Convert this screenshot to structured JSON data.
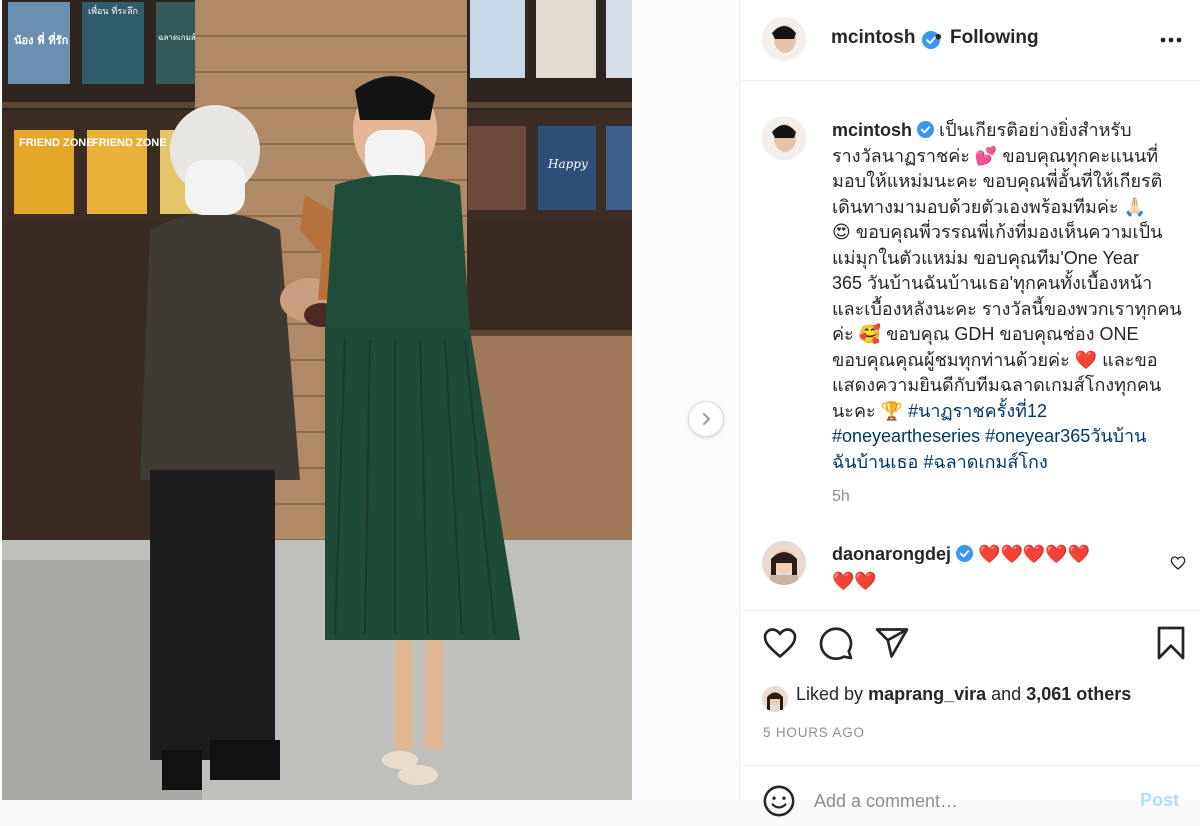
{
  "post": {
    "author": {
      "username": "mcintosh",
      "verified": true,
      "follow_status": "Following",
      "separator": "•"
    },
    "caption": {
      "username": "mcintosh",
      "lines": [
        "เป็นเกียรติอย่างยิ่งสำหรับ",
        "รางวัลนาฏราชค่ะ 💕 ขอบคุณทุกคะแนนที่",
        "มอบให้แหม่มนะคะ ขอบคุณพี่อั้นที่ให้เกียรติ",
        "เดินทางมามอบด้วยตัวเองพร้อมทีมค่ะ 🙏🏻",
        "😍 ขอบคุณพี่วรรณพี่เก้งที่มองเห็นความเป็น",
        "แม่มุกในตัวแหม่ม ขอบคุณทีม'One Year",
        "365 วันบ้านฉันบ้านเธอ'ทุกคนทั้งเบื้องหน้า",
        "และเบื้องหลังนะคะ รางวัลนี้ของพวกเราทุกคน",
        "ค่ะ 🥰 ขอบคุณ GDH ขอบคุณช่อง ONE",
        "ขอบคุณคุณผู้ชมทุกท่านด้วยค่ะ ❤️ และขอ",
        "แสดงความยินดีกับทีมฉลาดเกมส์โกงทุกคน"
      ],
      "last_line_prefix": "นะคะ 🏆 ",
      "hashtags": [
        "#นาฏราชครั้งที่12",
        "#oneyeartheseries",
        "#oneyear365วันบ้าน",
        "ฉันบ้านเธอ",
        "#ฉลาดเกมส์โกง"
      ],
      "age": "5h"
    },
    "comments": [
      {
        "username": "daonarongdej",
        "verified": true,
        "text_line1": "❤️❤️❤️❤️❤️",
        "text_line2": "❤️❤️"
      }
    ],
    "likes": {
      "prefix": "Liked by",
      "liked_by_user": "maprang_vira",
      "connector": "and",
      "others": "3,061 others"
    },
    "timestamp": "5 HOURS AGO",
    "comment_box": {
      "placeholder": "Add a comment…",
      "post_label": "Post"
    }
  },
  "icons": {
    "next": "chevron-right-icon",
    "more": "more-options-icon",
    "verified": "verified-badge-icon",
    "like": "heart-icon",
    "comment": "comment-icon",
    "share": "share-icon",
    "save": "bookmark-icon",
    "emoji": "emoji-icon"
  },
  "colors": {
    "text": "#262626",
    "secondary": "#8e8e8e",
    "link": "#00376b",
    "verified_blue": "#3897f0",
    "border": "#efefef",
    "post_button": "#b2dffc",
    "dress_green": "#1f4d3a",
    "heart_red": "#d01a2a"
  },
  "photo": {
    "posters_left": [
      "น้อง พี่ ที่รัก",
      "เพื่อน ที่ระลึก",
      "ฉลาดเกมส์"
    ],
    "posters_mid": [
      "FRIEND ZONE",
      "FRIEND ZONE"
    ],
    "posters_right": [
      "Happy"
    ]
  }
}
